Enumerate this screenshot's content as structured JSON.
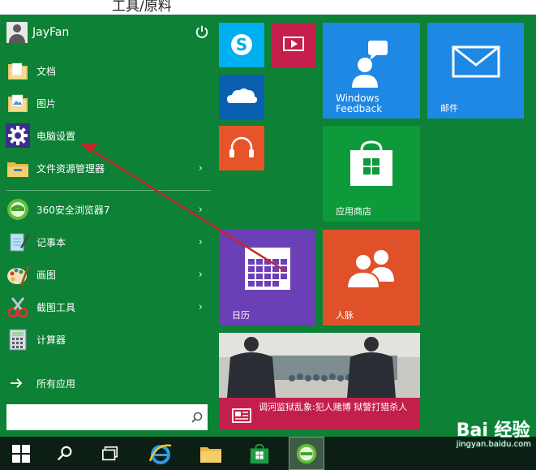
{
  "page_heading": "工具/原料",
  "user": {
    "name": "JayFan"
  },
  "menu": {
    "pinned": [
      {
        "label": "文档",
        "icon": "folder-icon"
      },
      {
        "label": "图片",
        "icon": "folder-icon"
      },
      {
        "label": "电脑设置",
        "icon": "gear-icon"
      },
      {
        "label": "文件资源管理器",
        "icon": "file-explorer-icon",
        "has_submenu": true
      }
    ],
    "recent": [
      {
        "label": "360安全浏览器7",
        "icon": "browser-360-icon",
        "has_submenu": true
      },
      {
        "label": "记事本",
        "icon": "notepad-icon",
        "has_submenu": true
      },
      {
        "label": "画图",
        "icon": "paint-icon",
        "has_submenu": true
      },
      {
        "label": "截图工具",
        "icon": "snipping-tool-icon",
        "has_submenu": true
      },
      {
        "label": "计算器",
        "icon": "calculator-icon",
        "has_submenu": false
      }
    ],
    "all_apps": "所有应用",
    "arrow": "›"
  },
  "search": {
    "value": "",
    "placeholder": ""
  },
  "tiles": {
    "windows_feedback": "Windows\nFeedback",
    "mail": "邮件",
    "store": "应用商店",
    "calendar": "日历",
    "people": "人脉",
    "news_headline": "调河监狱乱象:犯人赌博 狱警打猎杀人"
  },
  "colors": {
    "start_bg": "#0d8135",
    "skype": "#00aff0",
    "video": "#c41e4b",
    "onedrive": "#0a5fb0",
    "music": "#e8542a",
    "feedback": "#1e88e5",
    "mail": "#1e88e5",
    "store": "#0c9a3a",
    "calendar": "#6b3fb5",
    "people": "#e0512a",
    "news": "#c41e4b"
  },
  "watermark": {
    "line1": "Bai 经验",
    "line2": "jingyan.baidu.com"
  }
}
